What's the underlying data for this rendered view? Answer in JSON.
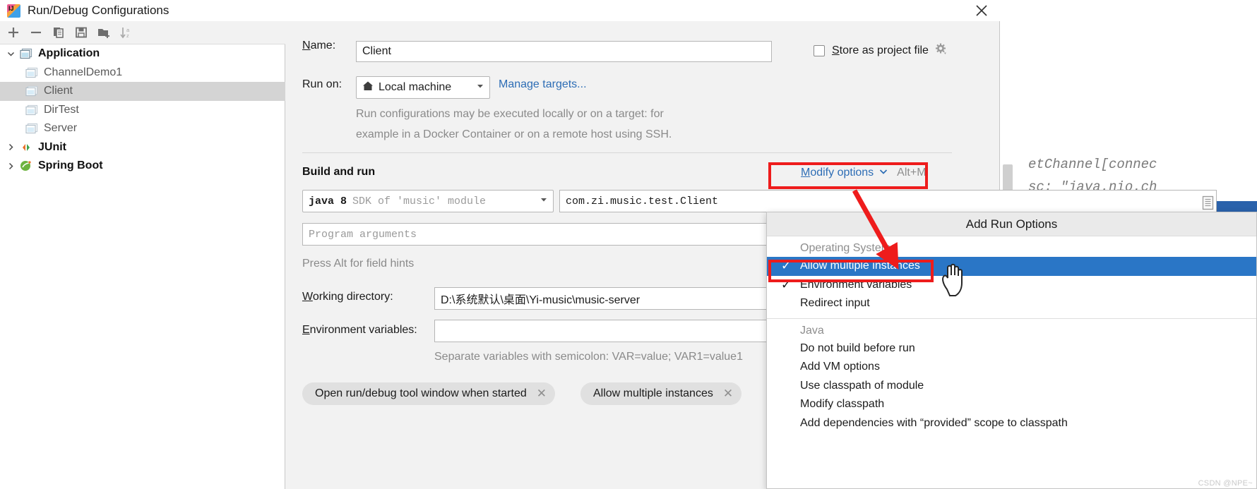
{
  "window": {
    "title": "Run/Debug Configurations",
    "app_icon": "intellij-idea-icon",
    "close_label": "✕"
  },
  "toolbar": {
    "buttons": [
      {
        "name": "add-configuration-button",
        "icon": "plus-icon",
        "label": "+"
      },
      {
        "name": "remove-configuration-button",
        "icon": "minus-icon",
        "label": "−"
      },
      {
        "name": "copy-configuration-button",
        "icon": "copy-icon",
        "label": ""
      },
      {
        "name": "save-configuration-button",
        "icon": "save-icon",
        "label": ""
      },
      {
        "name": "move-into-folder-button",
        "icon": "folder-add-icon",
        "label": ""
      },
      {
        "name": "sort-configurations-button",
        "icon": "sort-alpha-icon",
        "label": ""
      }
    ]
  },
  "tree": {
    "nodes": [
      {
        "label": "Application",
        "type": "group",
        "expanded": true,
        "icon": "application-icon",
        "selected": false
      },
      {
        "label": "ChannelDemo1",
        "type": "child",
        "icon": "application-icon",
        "selected": false
      },
      {
        "label": "Client",
        "type": "child",
        "icon": "application-icon",
        "selected": true
      },
      {
        "label": "DirTest",
        "type": "child",
        "icon": "application-icon",
        "selected": false
      },
      {
        "label": "Server",
        "type": "child",
        "icon": "application-icon",
        "selected": false
      },
      {
        "label": "JUnit",
        "type": "group",
        "expanded": false,
        "icon": "junit-icon",
        "selected": false
      },
      {
        "label": "Spring Boot",
        "type": "group",
        "expanded": false,
        "icon": "spring-boot-icon",
        "selected": false
      }
    ]
  },
  "form": {
    "name_label": "Name:",
    "name_value": "Client",
    "store_as_project_file_label": "Store as project file",
    "store_as_project_file_checked": false,
    "store_gear_icon": "gear-icon",
    "run_on_label": "Run on:",
    "run_on_value": "Local machine",
    "run_on_icon": "home-icon",
    "manage_targets_link": "Manage targets...",
    "run_on_description_line1": "Run configurations may be executed locally or on a target: for",
    "run_on_description_line2": "example in a Docker Container or on a remote host using SSH.",
    "build_and_run_title": "Build and run",
    "modify_options_label": "Modify options",
    "modify_options_shortcut": "Alt+M",
    "jre_value_bold": "java 8",
    "jre_value_dim": "SDK of 'music' module",
    "main_class_value": "com.zi.music.test.Client",
    "main_class_browse_icon": "class-browse-icon",
    "program_arguments_placeholder": "Program arguments",
    "field_hints_text": "Press Alt for field hints",
    "working_directory_label": "Working directory:",
    "working_directory_value": "D:\\系统默认\\桌面\\Yi-music\\music-server",
    "environment_variables_label": "Environment variables:",
    "environment_variables_value": "",
    "environment_variables_hint": "Separate variables with semicolon: VAR=value; VAR1=value1",
    "chips": [
      {
        "label": "Open run/debug tool window when started",
        "remove_icon": "close-icon"
      },
      {
        "label": "Allow multiple instances",
        "remove_icon": "close-icon"
      }
    ]
  },
  "popup": {
    "header": "Add Run Options",
    "groups": [
      {
        "label": "Operating System",
        "items": [
          {
            "label": "Allow multiple instances",
            "checked": true,
            "highlighted": true
          },
          {
            "label": "Environment variables",
            "checked": true,
            "highlighted": false
          },
          {
            "label": "Redirect input",
            "checked": false,
            "highlighted": false
          }
        ]
      },
      {
        "label": "Java",
        "items": [
          {
            "label": "Do not build before run",
            "checked": false,
            "highlighted": false
          },
          {
            "label": "Add VM options",
            "checked": false,
            "highlighted": false
          },
          {
            "label": "Use classpath of module",
            "checked": false,
            "highlighted": false
          },
          {
            "label": "Modify classpath",
            "checked": false,
            "highlighted": false
          },
          {
            "label": "Add dependencies with  “provided”  scope to classpath",
            "checked": false,
            "highlighted": false
          }
        ]
      }
    ]
  },
  "background_editor": {
    "code_lines": [
      "etChannel[connec",
      "sc: \"java.nio.ch"
    ],
    "scrollbar": "vertical-scrollbar"
  },
  "annotations": {
    "highlight_color": "#ee1c1c",
    "arrow_icon": "red-arrow-annotation",
    "cursor_icon": "hand-cursor",
    "watermark": "CSDN @NPE~"
  },
  "colors": {
    "selection_blue": "#2a76c6",
    "link_blue": "#2d6db5",
    "dialog_bg": "#f2f2f2",
    "annotation_red": "#ee1c1c"
  }
}
